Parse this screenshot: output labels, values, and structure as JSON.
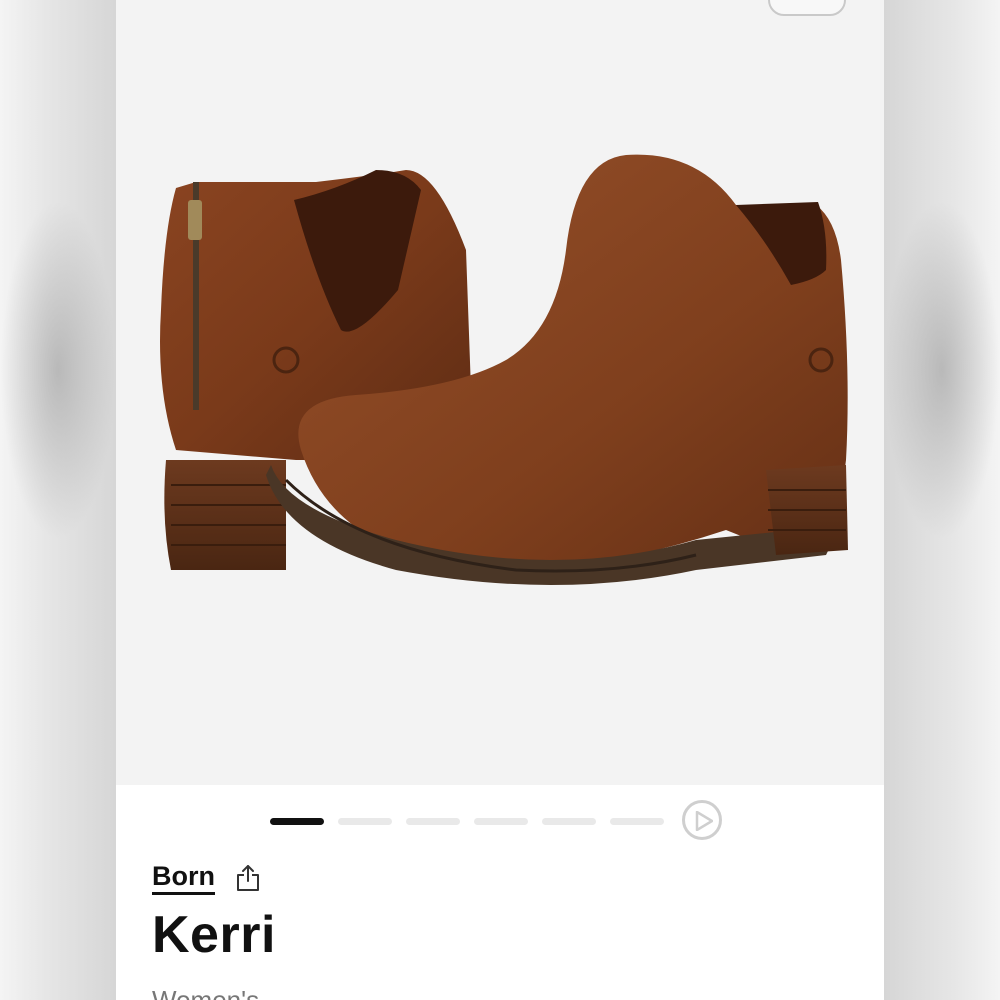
{
  "gallery": {
    "image_icon": "ankle-boots-image",
    "page_count": 6,
    "active_page": 1,
    "play_icon": "play-icon"
  },
  "product": {
    "brand": "Born",
    "name": "Kerri",
    "category": "Women's",
    "share_icon": "share-icon"
  },
  "colors": {
    "accent": "#111111",
    "boot_leather": "#7a3b1c",
    "gallery_bg": "#f3f3f3",
    "inactive_dot": "#e9e9e9"
  }
}
